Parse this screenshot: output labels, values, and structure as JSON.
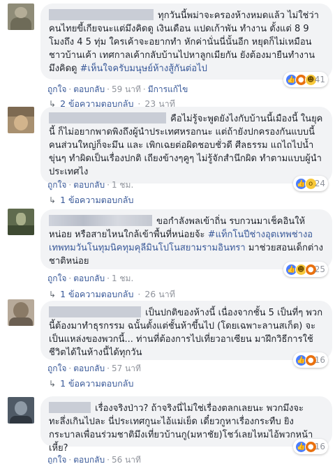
{
  "comments": [
    {
      "text": "ทุกวันนี้พม่าจะครองห้างหมดแล้ว ไม่ใช่ว่าคนไทยขี้เกียจนะแต่มึงคิดดู เงินเดือน แปดเก้าพัน ทำงาน ตั้งแต่ 8 9 โมงถึง 4 5 ทุ่ม ใครเค้าจะอยากทำ หักค่านั่นนี่นั้นอีก หยุดก็ไม่เหมือนชาวบ้านเค้า เทศกาลเค้ากลับบ้านไปหาลูกเมียกัน ยังต้องมายืนทำงาน มึงคิดดู",
      "tag": "#เห็นใจครับมนุษย์ห้างสู้กันต่อไป",
      "reaction_count": "41",
      "like": "ถูกใจ",
      "reply": "ตอบกลับ",
      "time": "59 นาที",
      "edited": "มีการแก้ไข",
      "replies_label": "2 ข้อความตอบกลับ",
      "replies_time": "23 นาที"
    },
    {
      "text": "คือไม่รู้จะพูดยังไงกับบ้านนี้เมืองนี้ ในยุคนี้ ก็ไม่อยากพาดพิงถึงผู้นำประเทศหรอกนะ แต่ถ้ายังปกครองกันแบบนี้ คนส่วนใหญ่ก็จะมึน และ เพิกเฉยต่อผิดชอบชั่วดี ศีลธรรม แถไถไปน้ำขุ่นๆ ทำผิดเป็นเรื่องปกติ เถียงข้างๆคูๆ ไม่รู้จักสำนึกผิด ทำตามแบบผู้นำประเทศไง",
      "tag": "",
      "reaction_count": "24",
      "like": "ถูกใจ",
      "reply": "ตอบกลับ",
      "time": "1 ชม.",
      "edited": "",
      "replies_label": "1 ข้อความตอบกลับ",
      "replies_time": ""
    },
    {
      "text": "ขอกำลังพลเข้าถิ่น รบกวนมาเช็คอินให้หน่อย หรือสายไหนใกล้เข้าพื้นที่หน่อยจ้ะ",
      "tag": "#แท็กโนปีช่างอุตเทพช่างอเทพทมวันโนทุมนิคทุมคุลีมินโปโนสยามรามอินทรา",
      "text2": "มาช่วยสอนเด็กต่างชาติหน่อย",
      "reaction_count": "25",
      "like": "ถูกใจ",
      "reply": "ตอบกลับ",
      "time": "1 ชม.",
      "edited": "",
      "replies_label": "1 ข้อความตอบกลับ",
      "replies_time": "26 นาที"
    },
    {
      "text": "เป็นปกติของห้างนี้ เนื่องจากชั้น 5 เป็นที่ๆ พวกนี้ต้องมาทำธุรกรรม ฉนั้นตั้งแต่ชั้นห้าขึ้นไป (โดยเฉพาะลานสเก็ต) จะเป็นแหล่งของพวกนี้... ท่านที่ต้องการไปเที่ยวอาเซียน มาฝึกวิธีการใช้ชีวิตได้ในห้างนี้ได้ทุกวัน",
      "tag": "",
      "reaction_count": "16",
      "like": "ถูกใจ",
      "reply": "ตอบกลับ",
      "time": "57 นาที",
      "edited": "",
      "replies_label": "1 ข้อความตอบกลับ",
      "replies_time": ""
    },
    {
      "text": "เรื่องจริงป่าว? ถ้าจริงนี่ไม่ใช่เรื่องตลกเลยนะ พวกมึงจะทะลึ่งเกินไปละ นี่ประเทศกูนะไอ้แม่เย็ด เดี๋ยวกูหาเรื่องกระทืบ ยิงกระบาลเพื่อนร่วมชาติมึงเที่ยวบ้านกู(มหาชัย)โชว์เลยไหมไอ้พวกหน้าเหี้ย?",
      "tag": "",
      "reaction_count": "16",
      "like": "ถูกใจ",
      "reply": "ตอบกลับ",
      "time": "56 นาที",
      "edited": "",
      "replies_label": "",
      "replies_time": ""
    }
  ],
  "colors": {
    "link": "#385898",
    "meta": "#90949c",
    "bubble": "#f2f3f5"
  },
  "icons": {
    "like": "thumbs-up-icon",
    "angry": "angry-face-icon",
    "haha": "haha-face-icon",
    "wow": "wow-face-icon",
    "reply_arrow": "reply-arrow-icon"
  }
}
